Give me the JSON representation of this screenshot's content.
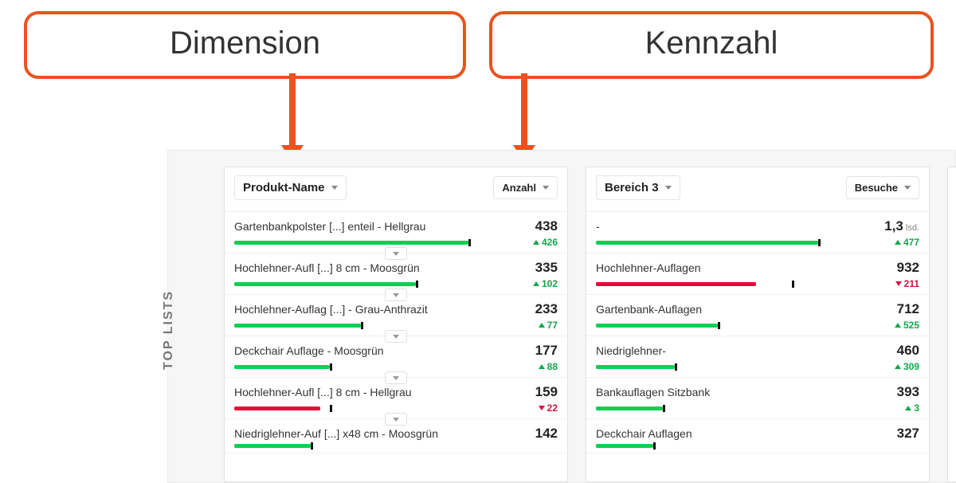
{
  "annotations": {
    "dimension": "Dimension",
    "kpi": "Kennzahl"
  },
  "side_label": "TOP LISTS",
  "panels": [
    {
      "dimension_label": "Produkt-Name",
      "metric_label": "Anzahl",
      "rows": [
        {
          "name": "Gartenbankpolster [...] enteil - Hellgrau",
          "value": "438",
          "unit": "",
          "delta": "426",
          "dir": "up",
          "bar_main": 98,
          "bar_base": 98,
          "expander": true
        },
        {
          "name": "Hochlehner-Aufl [...] 8 cm - Moosgrün",
          "value": "335",
          "unit": "",
          "delta": "102",
          "dir": "up",
          "bar_main": 76,
          "bar_base": 76,
          "expander": true
        },
        {
          "name": "Hochlehner-Auflag [...] - Grau-Anthrazit",
          "value": "233",
          "unit": "",
          "delta": "77",
          "dir": "up",
          "bar_main": 53,
          "bar_base": 53,
          "expander": true
        },
        {
          "name": "Deckchair Auflage - Moosgrün",
          "value": "177",
          "unit": "",
          "delta": "88",
          "dir": "up",
          "bar_main": 40,
          "bar_base": 40,
          "expander": true
        },
        {
          "name": "Hochlehner-Aufl [...] 8 cm - Hellgrau",
          "value": "159",
          "unit": "",
          "delta": "22",
          "dir": "down",
          "bar_main": 36,
          "bar_base": 40,
          "expander": true
        },
        {
          "name": "Niedriglehner-Auf [...] x48 cm - Moosgrün",
          "value": "142",
          "unit": "",
          "delta": "",
          "dir": "up",
          "bar_main": 32,
          "bar_base": 32,
          "expander": false
        }
      ]
    },
    {
      "dimension_label": "Bereich 3",
      "metric_label": "Besuche",
      "rows": [
        {
          "name": "-",
          "value": "1,3",
          "unit": "lsd.",
          "delta": "477",
          "dir": "up",
          "bar_main": 93,
          "bar_base": 93,
          "expander": false
        },
        {
          "name": "Hochlehner-Auflagen",
          "value": "932",
          "unit": "",
          "delta": "211",
          "dir": "down",
          "bar_main": 67,
          "bar_base": 82,
          "expander": false
        },
        {
          "name": "Gartenbank-Auflagen",
          "value": "712",
          "unit": "",
          "delta": "525",
          "dir": "up",
          "bar_main": 51,
          "bar_base": 51,
          "expander": false
        },
        {
          "name": "Niedriglehner-",
          "value": "460",
          "unit": "",
          "delta": "309",
          "dir": "up",
          "bar_main": 33,
          "bar_base": 33,
          "expander": false
        },
        {
          "name": "Bankauflagen Sitzbank",
          "value": "393",
          "unit": "",
          "delta": "3",
          "dir": "up",
          "bar_main": 28,
          "bar_base": 28,
          "expander": false
        },
        {
          "name": "Deckchair Auflagen",
          "value": "327",
          "unit": "",
          "delta": "",
          "dir": "up",
          "bar_main": 24,
          "bar_base": 24,
          "expander": false
        }
      ]
    }
  ]
}
